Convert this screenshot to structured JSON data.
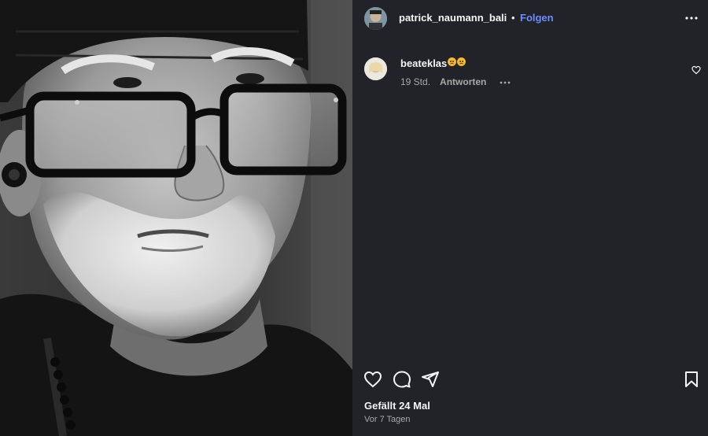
{
  "post": {
    "owner_username": "patrick_naumann_bali",
    "separator": "•",
    "follow_label": "Folgen",
    "likes_text": "Gefällt 24 Mal",
    "time_text": "Vor 7 Tagen"
  },
  "comments": [
    {
      "username": "beateklas",
      "emoji": [
        "worried-face",
        "worried-face"
      ],
      "time": "19 Std.",
      "reply_label": "Antworten"
    }
  ],
  "icons": {
    "more": "more-horizontal-icon",
    "like": "heart-outline-icon",
    "comment": "speech-bubble-icon",
    "share": "paper-plane-icon",
    "save": "bookmark-icon"
  },
  "colors": {
    "side_background": "#212328",
    "follow": "#6b8cff",
    "text": "#f5f5f5",
    "secondary_text": "#a8a8a8"
  }
}
